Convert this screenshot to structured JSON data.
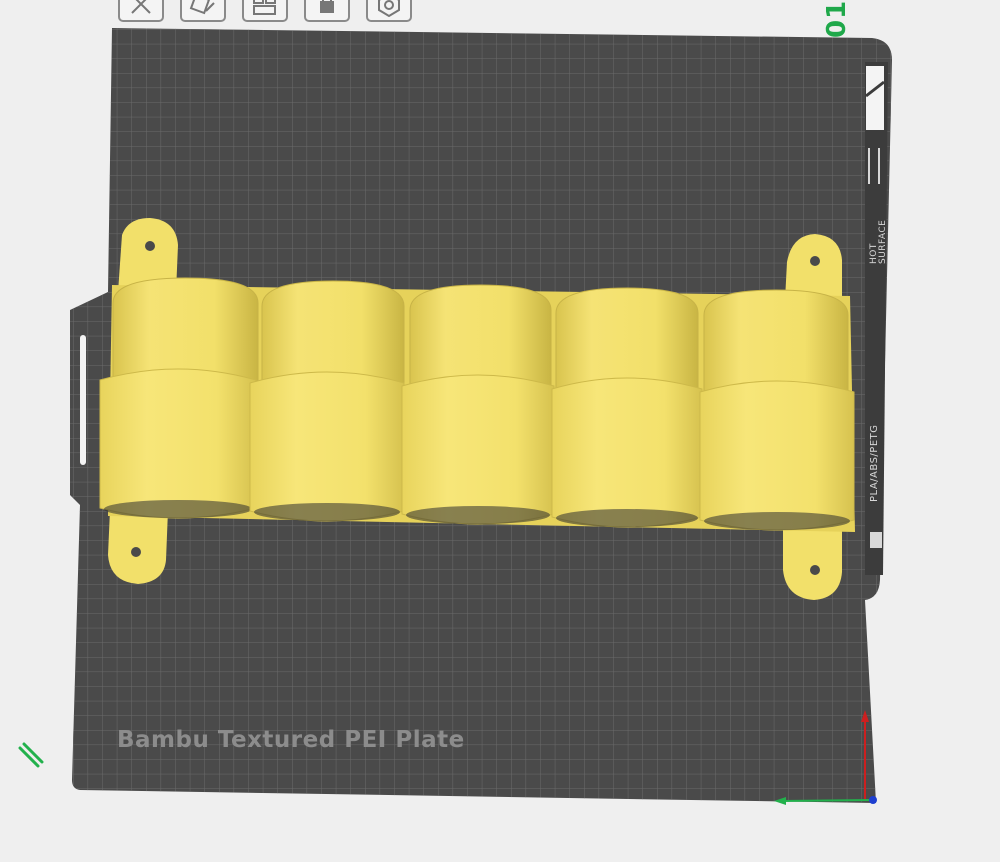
{
  "toolbar": {
    "buttons": [
      {
        "name": "delete-all-button",
        "icon": "close-box-icon"
      },
      {
        "name": "auto-orient-button",
        "icon": "auto-orient-icon"
      },
      {
        "name": "arrange-button",
        "icon": "arrange-icon"
      },
      {
        "name": "lock-plate-button",
        "icon": "lock-icon"
      },
      {
        "name": "plate-settings-button",
        "icon": "gear-icon"
      }
    ]
  },
  "plate": {
    "number": "01",
    "label": "Bambu Textured PEI Plate",
    "side_text": {
      "material": "PLA/ABS/PETG",
      "warning_line1": "HOT",
      "warning_line2": "SURFACE"
    }
  },
  "colors": {
    "background": "#efefef",
    "plate": "#4a4a4a",
    "grid": "#6b6b6b",
    "model": "#f2e06a",
    "axis_x": "#cc1f1f",
    "axis_y": "#22b14c",
    "axis_z": "#1e3fd0",
    "plate_number": "#1fa84a"
  },
  "icons": {
    "pencil": "pencil-icon"
  }
}
